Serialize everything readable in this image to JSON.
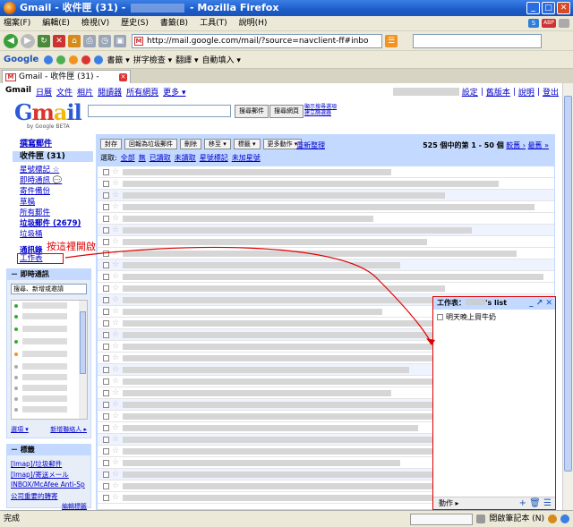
{
  "window": {
    "title_prefix": "Gmail - 收件匣 (31) -",
    "title_suffix": "- Mozilla Firefox"
  },
  "menu": [
    "檔案(F)",
    "編輯(E)",
    "檢視(V)",
    "歷史(S)",
    "書籤(B)",
    "工具(T)",
    "說明(H)"
  ],
  "menu_right": {
    "letter": "S",
    "abp": "ABP"
  },
  "url": "http://mail.google.com/mail/?source=navclient-ff#inbo",
  "google_toolbar": {
    "logo": "Google",
    "bookmarks": "書籤 ▾",
    "spell": "拼字檢查 ▾",
    "translate": "翻譯 ▾",
    "autofill": "自動填入 ▾"
  },
  "tab": {
    "label": "Gmail - 收件匣 (31) -"
  },
  "gmail": {
    "topnav": [
      "Gmail",
      "日曆",
      "文件",
      "相片",
      "閱讀器",
      "所有網頁",
      "更多 ▾"
    ],
    "toplinks": [
      "設定",
      "舊版本",
      "說明",
      "登出"
    ],
    "logo_by": "by Google BETA",
    "search_mail": "搜尋郵件",
    "search_web": "搜尋網頁",
    "search_opts": [
      "顯示搜尋選項",
      "建立篩選器"
    ],
    "compose": "撰寫郵件",
    "inbox": "收件匣 (31)",
    "nav": [
      "星號標記 ☆",
      "即時通訊 💬",
      "寄件備份",
      "草稿",
      "所有郵件",
      "垃圾郵件 (2679)",
      "垃圾桶"
    ],
    "contacts": "通訊錄",
    "tasks": "工作表",
    "annotation": "按這裡開啟todo列表",
    "chat": {
      "title": "－ 即時通訊",
      "search_placeholder": "搜尋、新增或邀請",
      "status": "選項 ▾",
      "invite": "新增聯絡人 ▸"
    },
    "labels": {
      "title": "－ 標籤",
      "items": [
        "[Imap]/垃圾郵件",
        "[Imap]/寄送メール",
        "INBOX/McAfee Anti-Sp",
        "公司重要的轉寄"
      ],
      "edit": "編輯標籤"
    }
  },
  "main": {
    "actions": [
      "封存",
      "回報為垃圾郵件",
      "刪除",
      "移至 ▾",
      "標籤 ▾",
      "更多動作 ▾"
    ],
    "refresh": "重新整理",
    "pager": {
      "count": "525 個中的第 1 - 50 個",
      "newer": "較舊 ›",
      "oldest": "最舊 »"
    },
    "select": {
      "prefix": "選取:",
      "opts": [
        "全部",
        "無",
        "已讀取",
        "未讀取",
        "星號標記",
        "未加星號"
      ]
    }
  },
  "tasks_panel": {
    "title_prefix": "工作表：",
    "title_suffix": "'s list",
    "controls": "_ ↗ ✕",
    "item": "明天晚上買牛奶",
    "footer": "動作 ▸",
    "footer_icons": "+ 🗑 ☰"
  },
  "status": {
    "text": "完成",
    "right": "開啟筆記本 (N)"
  },
  "colors": {
    "annotation": "#e00000",
    "gmail_panel": "#c3d9ff"
  }
}
